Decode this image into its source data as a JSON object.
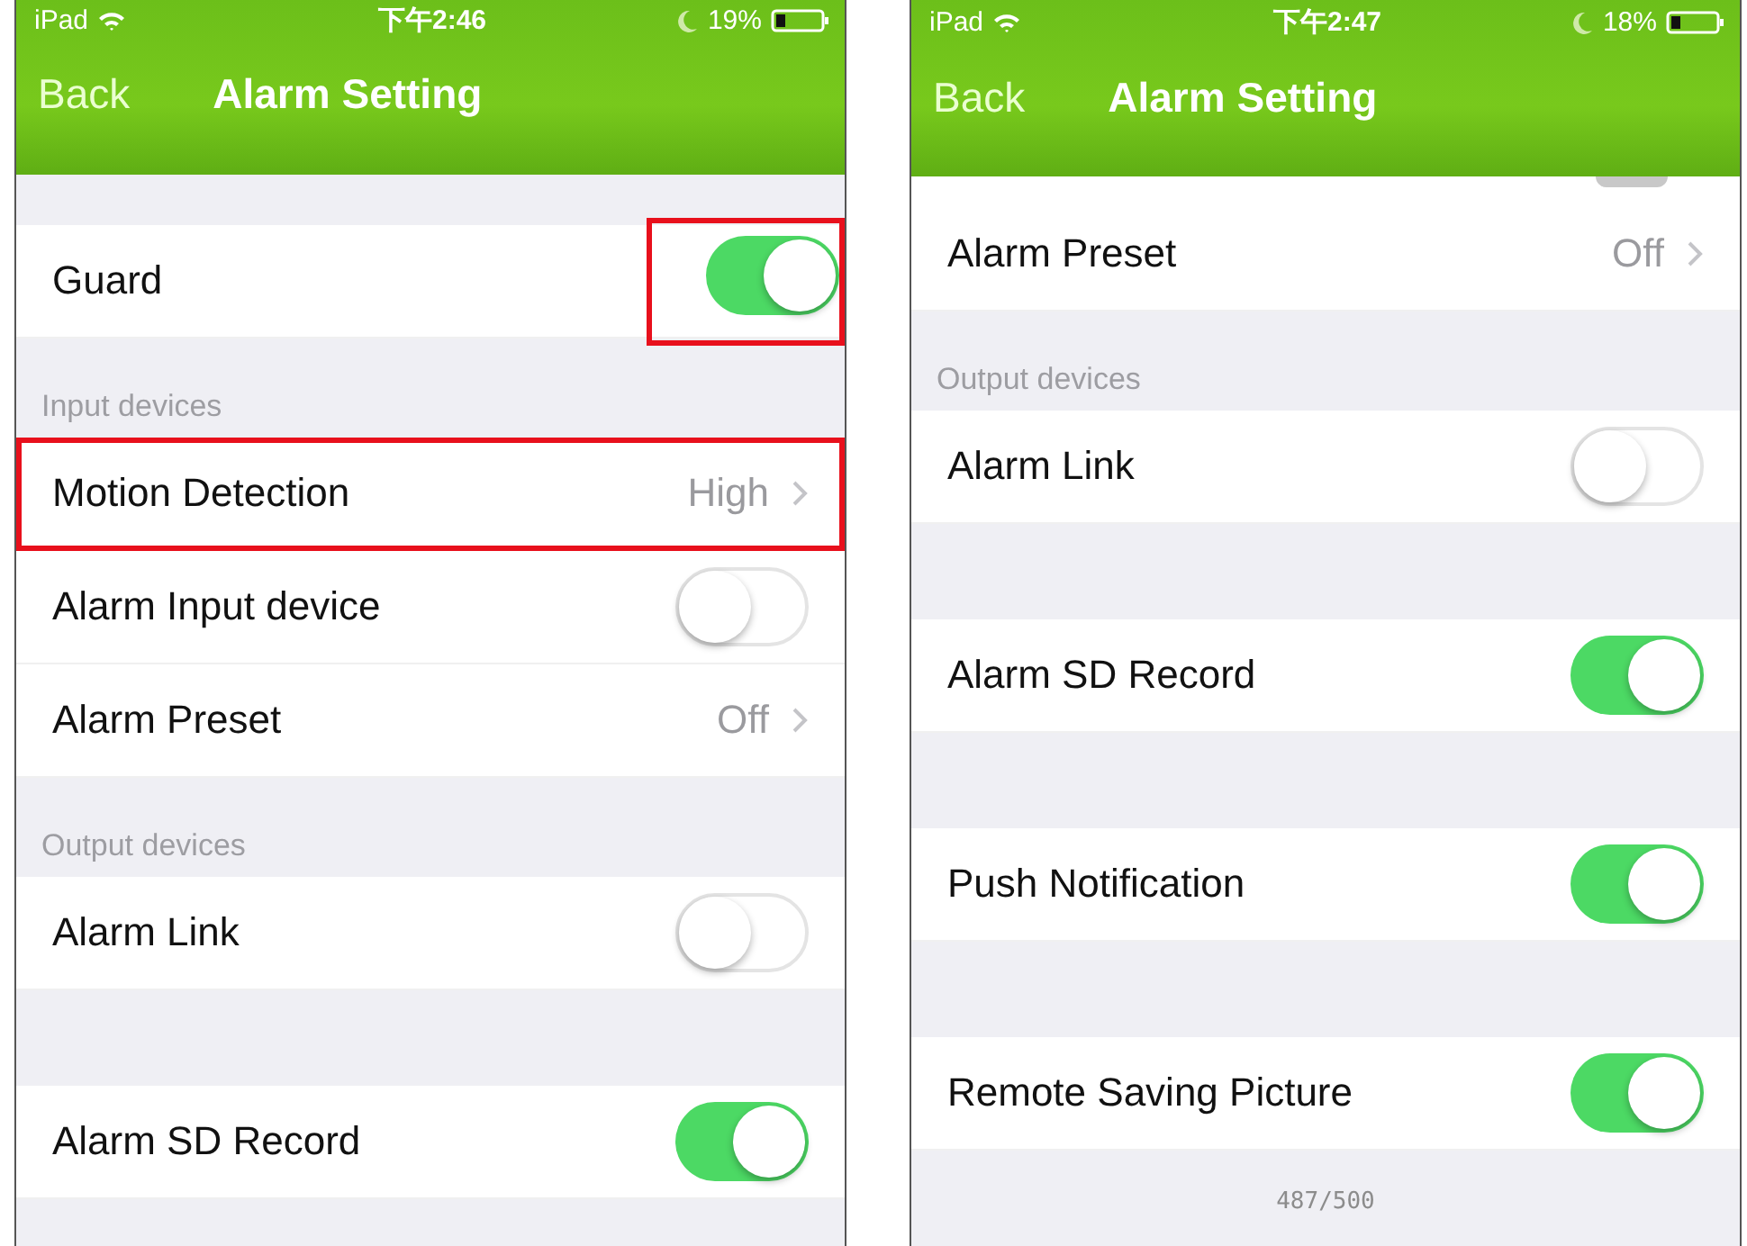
{
  "screens": [
    {
      "status_bar": {
        "carrier": "iPad",
        "time": "下午2:46",
        "battery": "19%"
      },
      "nav": {
        "back": "Back",
        "title": "Alarm Setting"
      },
      "items": [
        {
          "kind": "gap"
        },
        {
          "kind": "toggle",
          "label": "Guard",
          "on": true,
          "highlighted": true
        },
        {
          "kind": "header",
          "text": "Input devices"
        },
        {
          "kind": "value",
          "label": "Motion Detection",
          "value": "High",
          "highlighted": true
        },
        {
          "kind": "toggle",
          "label": "Alarm Input device",
          "on": false,
          "highlighted": false
        },
        {
          "kind": "value",
          "label": "Alarm Preset",
          "value": "Off",
          "highlighted": false
        },
        {
          "kind": "header",
          "text": "Output devices"
        },
        {
          "kind": "toggle",
          "label": "Alarm Link",
          "on": false,
          "highlighted": false
        },
        {
          "kind": "spacer"
        },
        {
          "kind": "toggle",
          "label": "Alarm SD Record",
          "on": true,
          "highlighted": false
        }
      ]
    },
    {
      "status_bar": {
        "carrier": "iPad",
        "time": "下午2:47",
        "battery": "18%"
      },
      "nav": {
        "back": "Back",
        "title": "Alarm Setting"
      },
      "footer": "487/500",
      "items": [
        {
          "kind": "cut"
        },
        {
          "kind": "value",
          "label": "Alarm Preset",
          "value": "Off",
          "highlighted": false
        },
        {
          "kind": "header",
          "text": "Output devices"
        },
        {
          "kind": "toggle",
          "label": "Alarm Link",
          "on": false,
          "highlighted": false
        },
        {
          "kind": "spacer"
        },
        {
          "kind": "toggle",
          "label": "Alarm SD Record",
          "on": true,
          "highlighted": false
        },
        {
          "kind": "spacer"
        },
        {
          "kind": "toggle",
          "label": "Push Notification",
          "on": true,
          "highlighted": false
        },
        {
          "kind": "spacer"
        },
        {
          "kind": "toggle",
          "label": "Remote Saving Picture",
          "on": true,
          "highlighted": false
        }
      ]
    }
  ]
}
